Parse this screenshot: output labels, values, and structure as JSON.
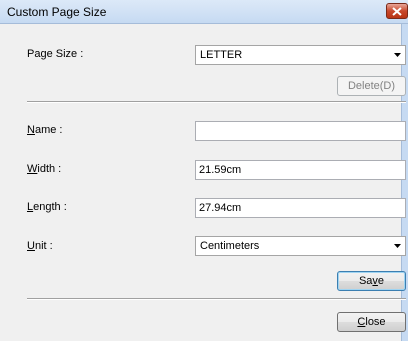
{
  "window": {
    "title": "Custom Page Size",
    "close_icon": "close-icon"
  },
  "page_size": {
    "label": "Page Size :",
    "selected": "LETTER",
    "delete_label": "Delete(D)"
  },
  "name": {
    "label_accel": "N",
    "label_rest": "ame :",
    "value": ""
  },
  "width": {
    "label_accel": "W",
    "label_rest": "idth :",
    "value": "21.59cm"
  },
  "length": {
    "label_accel": "L",
    "label_rest": "ength :",
    "value": "27.94cm"
  },
  "unit": {
    "label_accel": "U",
    "label_rest": "nit :",
    "selected": "Centimeters"
  },
  "buttons": {
    "save_pre": "Sa",
    "save_accel": "v",
    "save_post": "e",
    "close_accel": "C",
    "close_post": "lose"
  },
  "colors": {
    "title_bar": "#c6daf2",
    "close_button": "#c8482c",
    "dialog_bg": "#f0f0f0"
  }
}
